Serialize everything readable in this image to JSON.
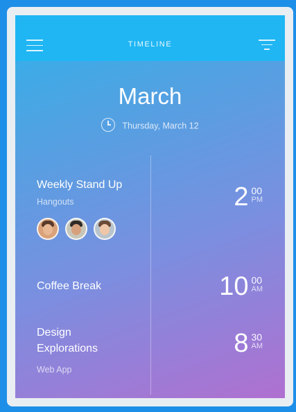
{
  "header": {
    "title": "TIMELINE",
    "menu_icon": "hamburger-menu-icon",
    "filter_icon": "filter-icon"
  },
  "calendar": {
    "month": "March",
    "date": "Thursday, March 12",
    "clock_icon": "clock-icon"
  },
  "events": [
    {
      "title": "Weekly Stand Up",
      "subtitle": "Hangouts",
      "hour": "2",
      "minutes": "00",
      "period": "PM",
      "attendees": [
        "attendee-1",
        "attendee-2",
        "attendee-3"
      ]
    },
    {
      "title": "Coffee Break",
      "hour": "10",
      "minutes": "00",
      "period": "AM"
    },
    {
      "title_line1": "Design",
      "title_line2": "Explorations",
      "subtitle": "Web App",
      "hour": "8",
      "minutes": "30",
      "period": "AM"
    }
  ],
  "colors": {
    "page_background": "#1e8fe8",
    "header_bar": "#1fb6f3",
    "gradient_top": "#2fb2ec",
    "gradient_bottom": "#b070d0",
    "text": "#ffffff"
  }
}
